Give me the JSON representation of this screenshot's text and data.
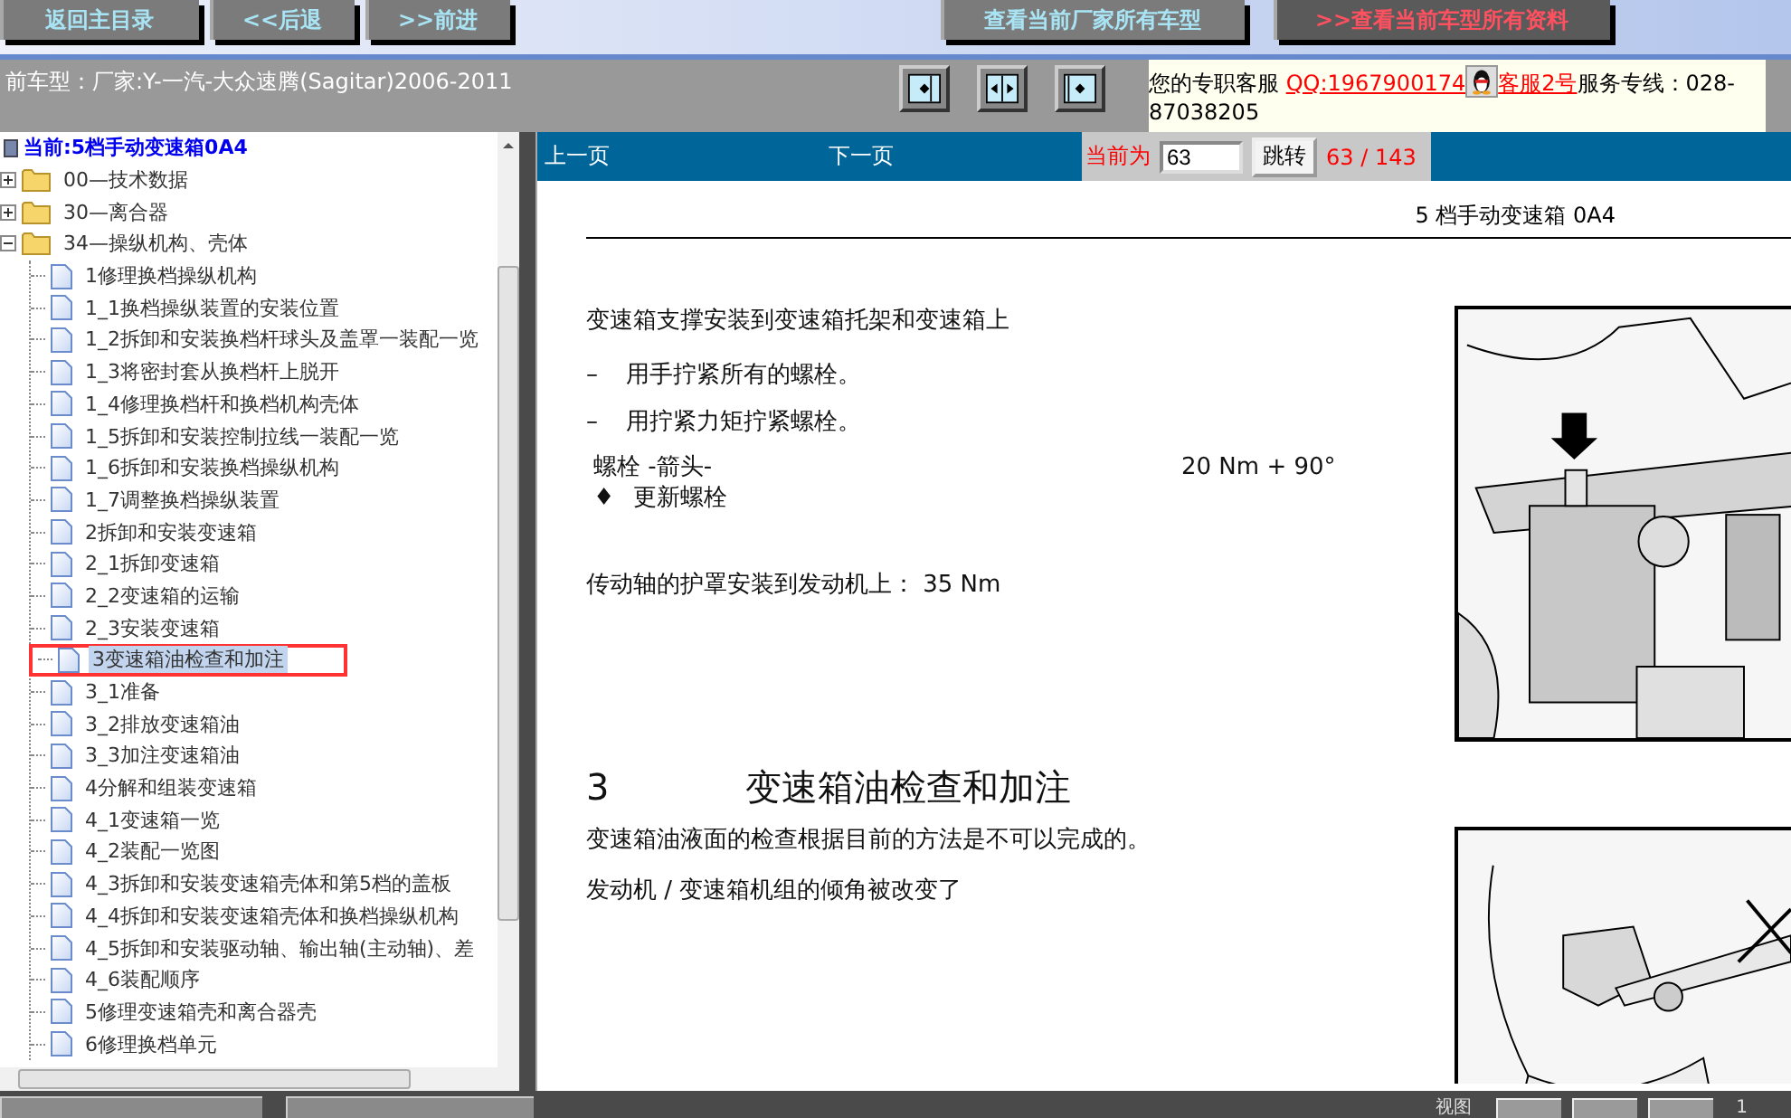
{
  "nav_buttons": [
    {
      "label": "返回主目录"
    },
    {
      "label": "<<后退"
    },
    {
      "label": ">>前进"
    }
  ],
  "catalog_buttons": [
    {
      "label": "查看当前厂家所有车型",
      "kind": "plain"
    },
    {
      "label": ">>查看当前车型所有资料",
      "kind": "highlight"
    }
  ],
  "vehicle": {
    "label": "前车型：厂家:Y-一汽-大众速腾(Sagitar)2006-2011"
  },
  "contact": {
    "intro": "您的专职客服 ",
    "qq_link": "QQ:1967900174",
    "agent_link": "客服2号",
    "hotline": "服务专线：028-87038205"
  },
  "tree": {
    "title": "当前:5档手动变速箱0A4",
    "items": [
      {
        "label": "00—技术数据",
        "expanded": false,
        "selected": false
      },
      {
        "label": "30—离合器",
        "expanded": false,
        "selected": false
      },
      {
        "label": "34—操纵机构、壳体",
        "expanded": true,
        "selected": false,
        "children": [
          {
            "label": "1修理换档操纵机构",
            "selected": false
          },
          {
            "label": "1_1换档操纵装置的安装位置",
            "selected": false
          },
          {
            "label": "1_2拆卸和安装换档杆球头及盖罩一装配一览",
            "selected": false
          },
          {
            "label": "1_3将密封套从换档杆上脱开",
            "selected": false
          },
          {
            "label": "1_4修理换档杆和换档机构壳体",
            "selected": false
          },
          {
            "label": "1_5拆卸和安装控制拉线一装配一览",
            "selected": false
          },
          {
            "label": "1_6拆卸和安装换档操纵机构",
            "selected": false
          },
          {
            "label": "1_7调整换档操纵装置",
            "selected": false
          },
          {
            "label": "2拆卸和安装变速箱",
            "selected": false
          },
          {
            "label": "2_1拆卸变速箱",
            "selected": false
          },
          {
            "label": "2_2变速箱的运输",
            "selected": false
          },
          {
            "label": "2_3安装变速箱",
            "selected": false
          },
          {
            "label": "3变速箱油检查和加注",
            "selected": true
          },
          {
            "label": "3_1准备",
            "selected": false
          },
          {
            "label": "3_2排放变速箱油",
            "selected": false
          },
          {
            "label": "3_3加注变速箱油",
            "selected": false
          },
          {
            "label": "4分解和组装变速箱",
            "selected": false
          },
          {
            "label": "4_1变速箱一览",
            "selected": false
          },
          {
            "label": "4_2装配一览图",
            "selected": false
          },
          {
            "label": "4_3拆卸和安装变速箱壳体和第5档的盖板",
            "selected": false
          },
          {
            "label": "4_4拆卸和安装变速箱壳体和换档操纵机构",
            "selected": false
          },
          {
            "label": "4_5拆卸和安装驱动轴、输出轴(主动轴)、差",
            "selected": false
          },
          {
            "label": "4_6装配顺序",
            "selected": false
          },
          {
            "label": "5修理变速箱壳和离合器壳",
            "selected": false
          },
          {
            "label": "6修理换档单元",
            "selected": false
          }
        ]
      }
    ]
  },
  "pager": {
    "prev": "上一页",
    "next": "下一页",
    "current_label": "当前为",
    "page_value": "63",
    "go_button": "跳转",
    "count": "63 / 143"
  },
  "document": {
    "header": "5 档手动变速箱 0A4",
    "sections": [
      {
        "blocks": [
          {
            "kind": "paragraph",
            "text": "变速箱支撑安装到变速箱托架和变速箱上"
          },
          {
            "kind": "step",
            "marker": "–",
            "text": "用手拧紧所有的螺栓。"
          },
          {
            "kind": "step",
            "marker": "–",
            "text": "用拧紧力矩拧紧螺栓。"
          },
          {
            "kind": "spec",
            "label": "螺栓 -箭头-",
            "value": "20 Nm + 90°"
          },
          {
            "kind": "note",
            "marker": "♦",
            "text": "更新螺栓"
          },
          {
            "kind": "paragraph",
            "text": "传动轴的护罩安装到发动机上： 35 Nm"
          }
        ]
      },
      {
        "blocks": [
          {
            "kind": "heading",
            "number": "3",
            "text": "变速箱油检查和加注"
          },
          {
            "kind": "paragraph",
            "text": "变速箱油液面的检查根据目前的方法是不可以完成的。"
          },
          {
            "kind": "paragraph",
            "text": "发动机 / 变速箱机组的倾角被改变了"
          }
        ]
      }
    ]
  },
  "bottom_bar": {
    "view_label": "视图",
    "page_number": "1"
  }
}
